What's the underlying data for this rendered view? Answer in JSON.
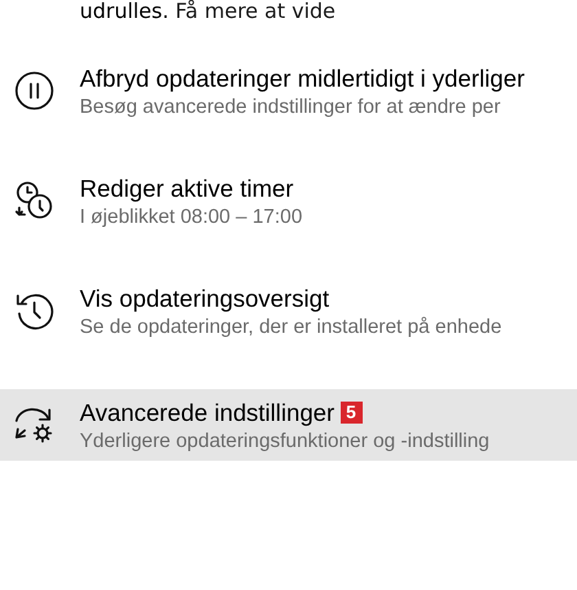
{
  "intro": {
    "text": "udrulles.",
    "link": "Få mere at vide"
  },
  "items": [
    {
      "title": "Afbryd opdateringer midlertidigt i yderliger",
      "subtitle": "Besøg avancerede indstillinger for at ændre per",
      "selected": false
    },
    {
      "title": "Rediger aktive timer",
      "subtitle": "I øjeblikket 08:00 – 17:00",
      "selected": false
    },
    {
      "title": "Vis opdateringsoversigt",
      "subtitle": "Se de opdateringer, der er installeret på enhede",
      "selected": false
    },
    {
      "title": "Avancerede indstillinger",
      "badge": "5",
      "subtitle": "Yderligere opdateringsfunktioner og -indstilling",
      "selected": true
    }
  ]
}
